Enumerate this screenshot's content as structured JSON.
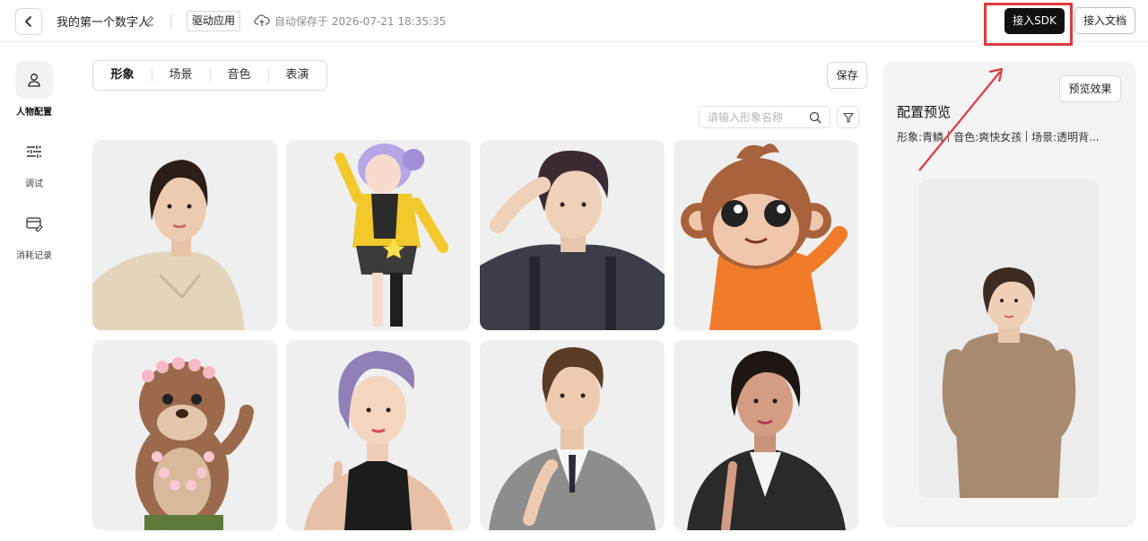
{
  "header": {
    "title": "我的第一个数字人",
    "drive_tag": "驱动应用",
    "autosave": "自动保存于 2026-07-21 18:35:35",
    "sdk_button": "接入SDK",
    "doc_button": "接入文档"
  },
  "sidebar": {
    "items": [
      {
        "label": "人物配置",
        "icon": "person-icon",
        "active": true
      },
      {
        "label": "调试",
        "icon": "sliders-icon",
        "active": false
      },
      {
        "label": "消耗记录",
        "icon": "card-record-icon",
        "active": false
      }
    ]
  },
  "tabs": [
    {
      "label": "形象",
      "active": true
    },
    {
      "label": "场景",
      "active": false
    },
    {
      "label": "音色",
      "active": false
    },
    {
      "label": "表演",
      "active": false
    }
  ],
  "save_button": "保存",
  "search": {
    "placeholder": "请输入形象名称"
  },
  "avatars": [
    {
      "name": "woman-beige-polo",
      "color": "#e3d6bf"
    },
    {
      "name": "anime-girl-yellow-jacket",
      "color": "#f0c52a"
    },
    {
      "name": "young-man-overalls",
      "color": "#3b3e45"
    },
    {
      "name": "cartoon-monkey-orange-shirt",
      "color": "#f07c2a"
    },
    {
      "name": "cartoon-otter-flower-crown",
      "color": "#9b6a4c"
    },
    {
      "name": "woman-purple-hair-halter",
      "color": "#1c1c1c"
    },
    {
      "name": "man-gray-suit",
      "color": "#8d8d8d"
    },
    {
      "name": "woman-black-blazer",
      "color": "#2a2a2a"
    }
  ],
  "preview": {
    "button": "预览效果",
    "title": "配置预览",
    "appearance_label": "形象:",
    "appearance_value": "青鳞",
    "voice_label": "音色:",
    "voice_value": "爽快女孩",
    "scene_label": "场景:",
    "scene_value": "透明背..."
  },
  "colors": {
    "accent": "#111111",
    "highlight": "#e0393e",
    "panel_bg": "#f4f4f4"
  }
}
